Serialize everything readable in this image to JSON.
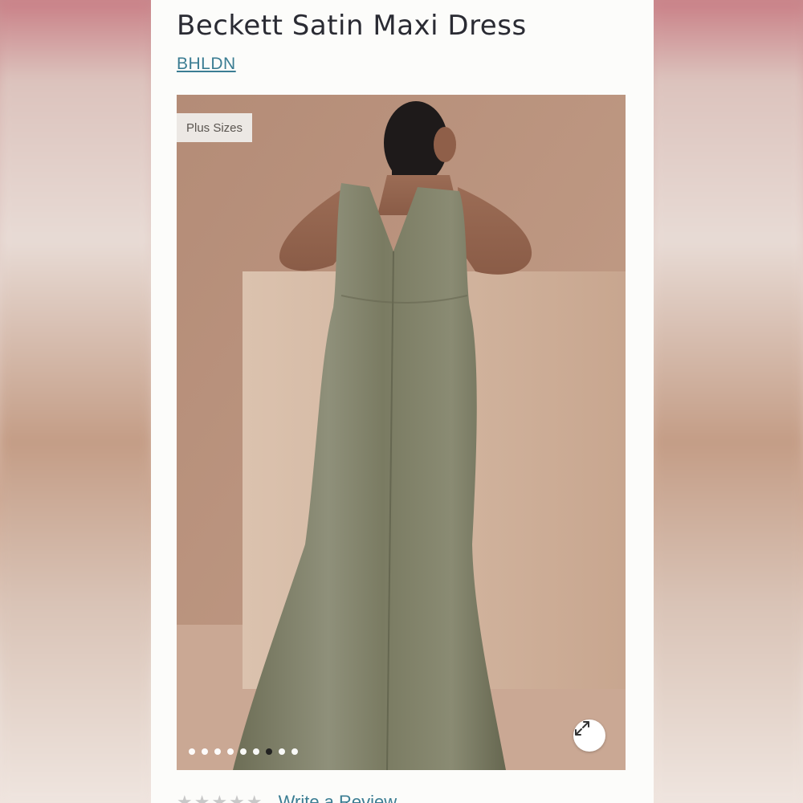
{
  "product": {
    "title": "Beckett Satin Maxi Dress",
    "brand": "BHLDN"
  },
  "gallery": {
    "badge": "Plus Sizes",
    "slide_count": 9,
    "active_index": 6,
    "expand_icon": "expand-arrows-icon"
  },
  "reviews": {
    "stars_glyph": "★★★★★",
    "rating": 0,
    "write_label": "Write a Review"
  },
  "colors": {
    "link": "#3b7d93",
    "dress": "#7f8066",
    "backdrop": "#bb9580"
  }
}
